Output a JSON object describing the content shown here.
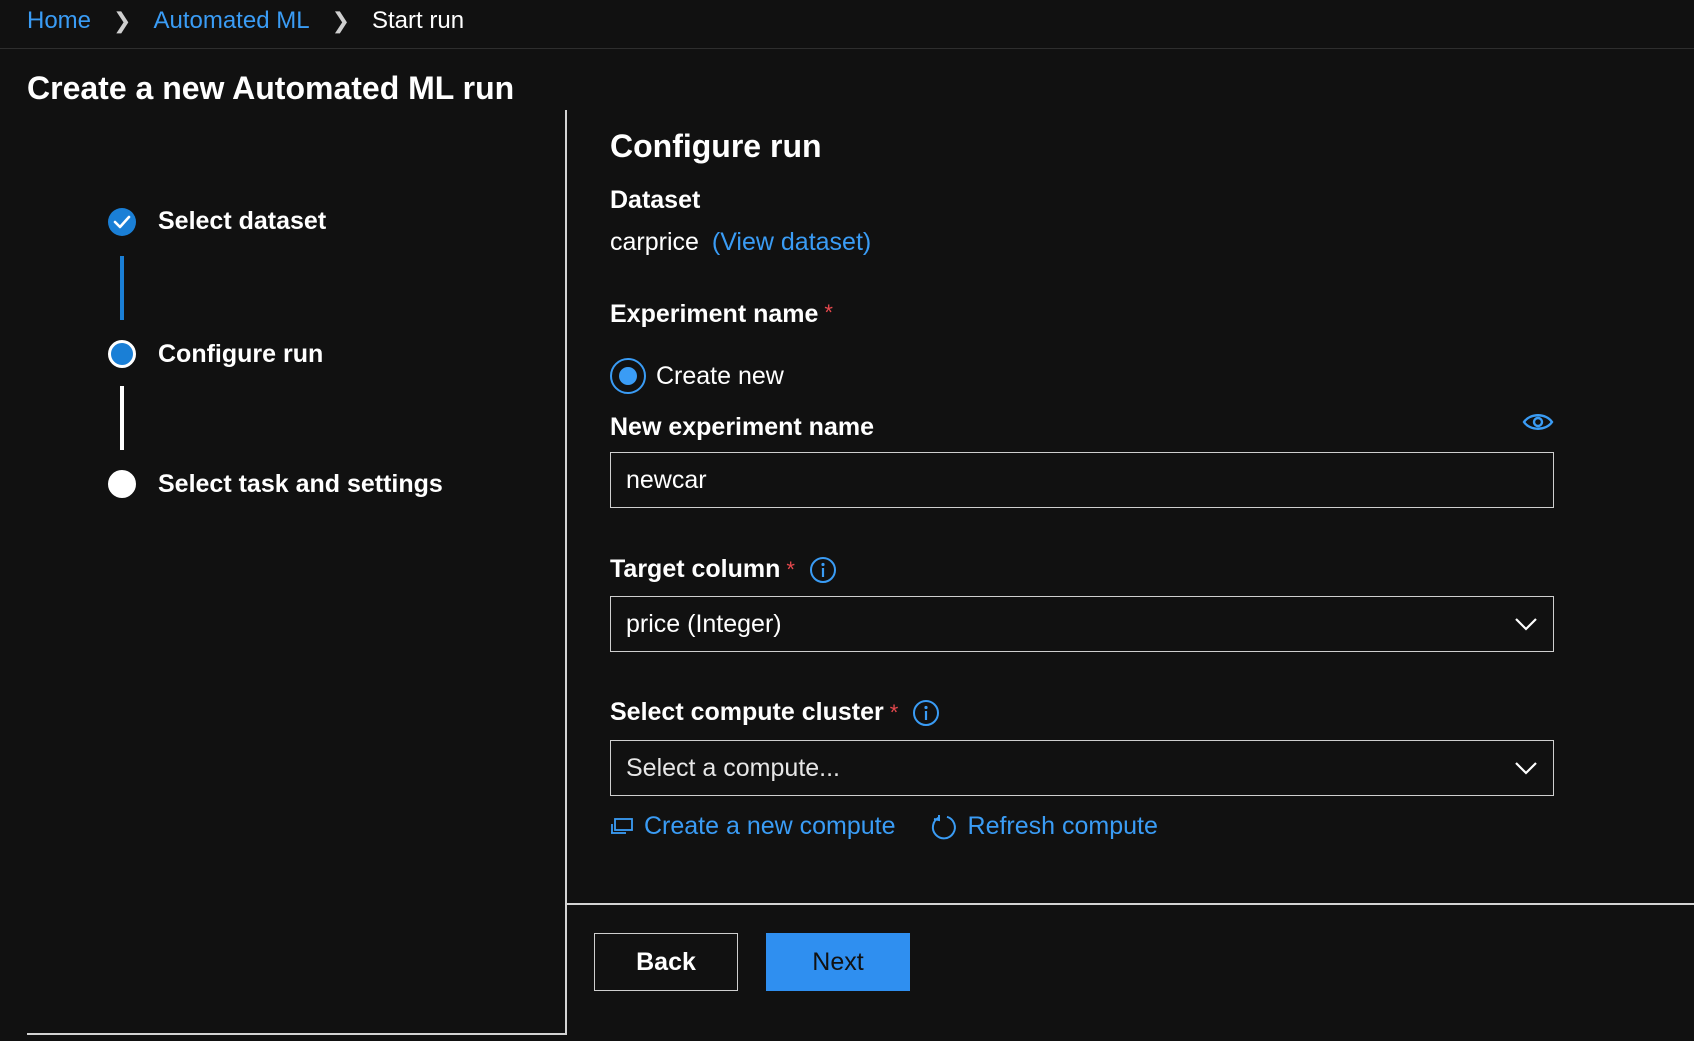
{
  "breadcrumb": {
    "items": [
      "Home",
      "Automated ML"
    ],
    "current": "Start run"
  },
  "page_title": "Create a new Automated ML run",
  "stepper": {
    "steps": [
      {
        "label": "Select dataset",
        "state": "complete"
      },
      {
        "label": "Configure run",
        "state": "active"
      },
      {
        "label": "Select task and settings",
        "state": "pending"
      }
    ]
  },
  "form": {
    "section_title": "Configure run",
    "dataset_label": "Dataset",
    "dataset_name": "carprice",
    "view_dataset_link": "(View dataset)",
    "experiment_label": "Experiment name",
    "required_marker": "*",
    "radio_create_new": "Create new",
    "new_experiment_label": "New experiment name",
    "new_experiment_value": "newcar",
    "target_column_label": "Target column",
    "target_column_value": "price (Integer)",
    "compute_label": "Select compute cluster",
    "compute_placeholder": "Select a compute...",
    "create_compute_link": "Create a new compute",
    "refresh_compute_link": "Refresh compute"
  },
  "footer": {
    "back_label": "Back",
    "next_label": "Next"
  },
  "icons": {
    "separator": "chevron-right-icon",
    "step_complete": "checkmark-circle-icon",
    "reveal": "eye-icon",
    "info": "info-icon",
    "dropdown": "chevron-down-icon",
    "create_compute": "computer-icon",
    "refresh": "refresh-icon"
  },
  "colors": {
    "background": "#111111",
    "accent": "#3a9cf5",
    "step_blue": "#1a7fd6",
    "primary_button": "#2f8ff0",
    "required": "#e5484d"
  }
}
